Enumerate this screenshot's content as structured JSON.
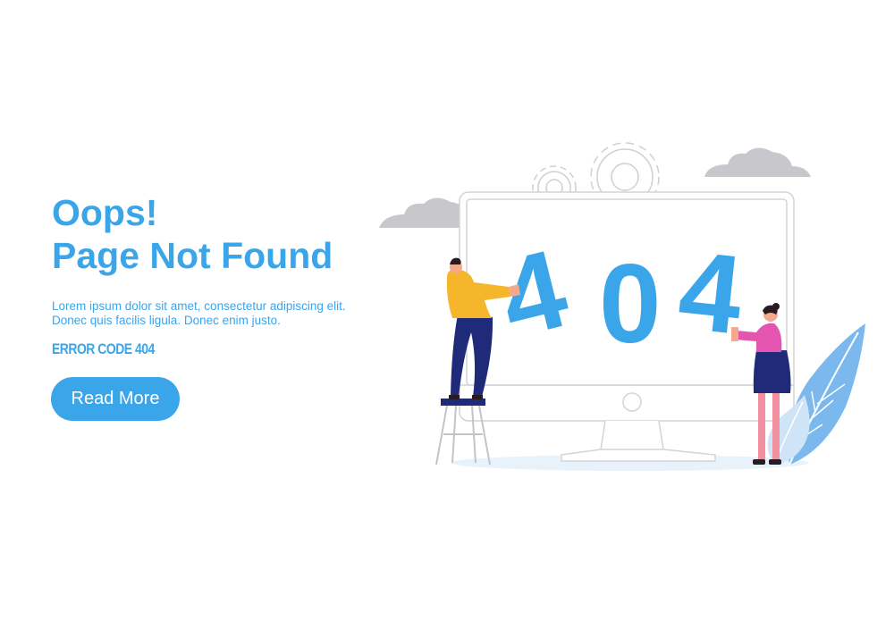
{
  "hero": {
    "title_line1": "Oops!",
    "title_line2": "Page Not Found",
    "description_line1": "Lorem ipsum dolor sit amet, consectetur adipiscing elit.",
    "description_line2": "Donec quis facilis ligula. Donec enim justo.",
    "error_code": "ERROR CODE 404",
    "button_label": "Read More"
  },
  "illustration": {
    "big_text": [
      "4",
      "0",
      "4"
    ]
  },
  "colors": {
    "accent": "#3ba5ea",
    "cloud": "#c8c8cc",
    "outline": "#d3d3d8",
    "shirt_yellow": "#f6b62c",
    "pants_navy": "#1f2a78",
    "top_pink": "#e455b0",
    "leg_pink": "#f28fa0",
    "leaf_blue": "#7ab8ee",
    "floor": "#e7f2fb"
  }
}
